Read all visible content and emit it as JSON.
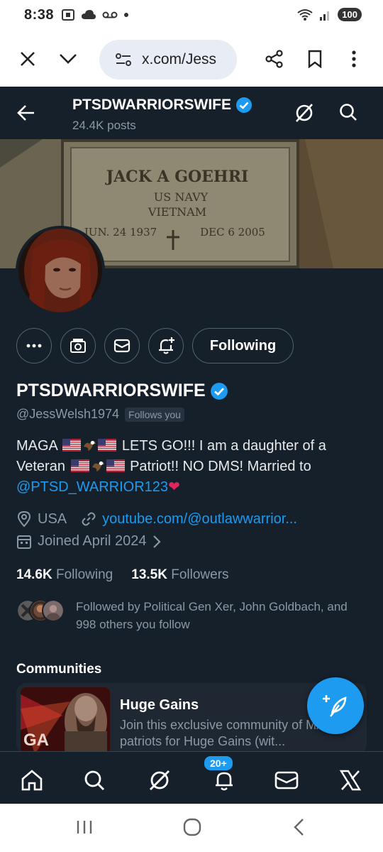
{
  "status_bar": {
    "time": "8:38",
    "battery": "100"
  },
  "browser": {
    "url": "x.com/Jess"
  },
  "header": {
    "display_name": "PTSDWARRIORSWIFE",
    "posts_count": "24.4K posts"
  },
  "banner": {
    "line1": "JACK A GOEHRI",
    "line2": "US NAVY",
    "line3": "VIETNAM",
    "date_left": "JUN. 24 1937",
    "date_right": "DEC 6 2005"
  },
  "actions": {
    "following_label": "Following"
  },
  "profile": {
    "display_name": "PTSDWARRIORSWIFE",
    "handle": "@JessWelsh1974",
    "follows_you": "Follows you",
    "bio_part1": "MAGA",
    "bio_part2": "LETS GO!!! I am a daughter of a Veteran",
    "bio_part3": "Patriot!! NO DMS! Married to",
    "bio_mention": "@PTSD_WARRIOR123",
    "bio_heart": "❤",
    "location": "USA",
    "website": "youtube.com/@outlawwarrior...",
    "joined": "Joined April 2024",
    "following_count": "14.6K",
    "following_label": "Following",
    "followers_count": "13.5K",
    "followers_label": "Followers",
    "followed_by": "Followed by Political Gen Xer, John Goldbach, and 998 others you follow"
  },
  "communities": {
    "heading": "Communities",
    "card": {
      "title": "Huge Gains",
      "description": "Join this exclusive community of MAGA patriots for Huge Gains (wit...",
      "thumb_text": "GA"
    }
  },
  "bottom_nav": {
    "notifications_badge": "20+"
  },
  "colors": {
    "background": "#15202b",
    "accent": "#1d9bf0",
    "secondary_text": "#8b98a5",
    "border": "#536471"
  }
}
